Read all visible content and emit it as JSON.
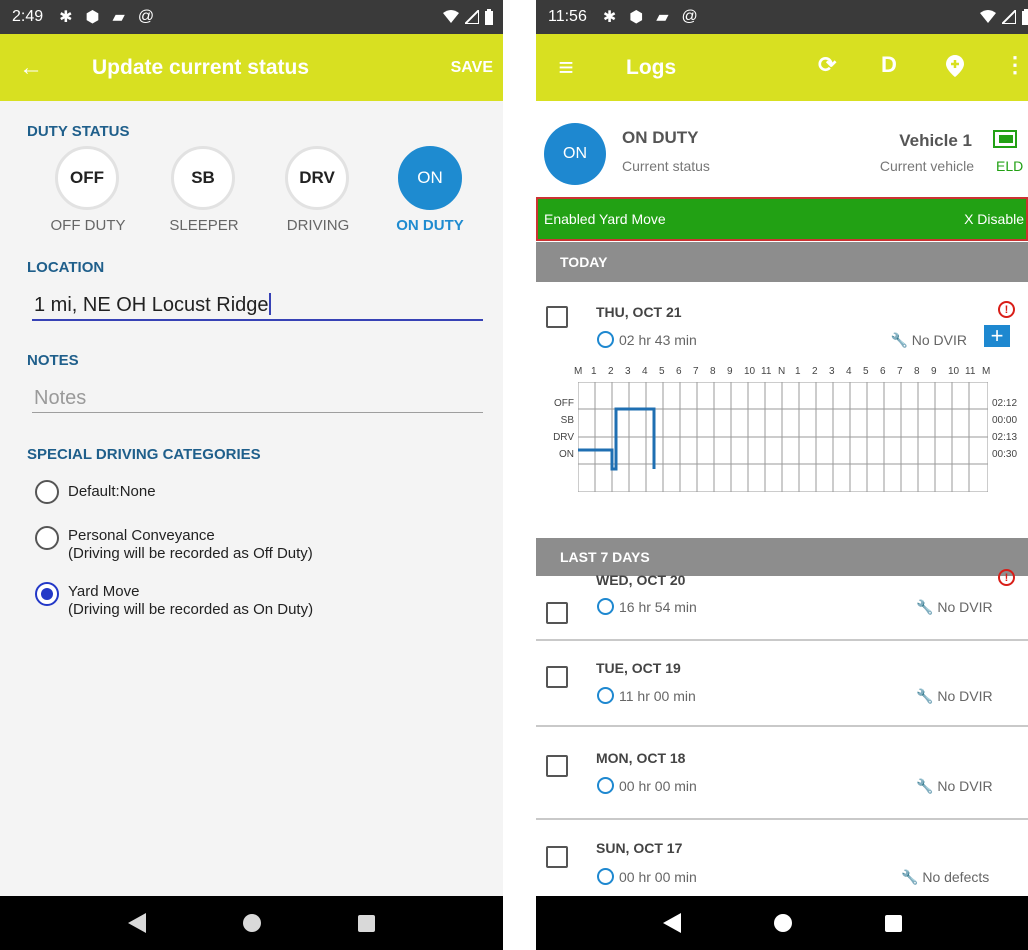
{
  "left": {
    "statusbar": {
      "time": "2:49"
    },
    "appbar": {
      "title": "Update current status",
      "save": "SAVE"
    },
    "duty_status": {
      "label": "DUTY STATUS",
      "options": [
        {
          "code": "OFF",
          "label": "OFF DUTY"
        },
        {
          "code": "SB",
          "label": "SLEEPER"
        },
        {
          "code": "DRV",
          "label": "DRIVING"
        },
        {
          "code": "ON",
          "label": "ON DUTY"
        }
      ],
      "selected": "ON"
    },
    "location": {
      "label": "LOCATION",
      "value": "1 mi, NE OH Locust Ridge"
    },
    "notes": {
      "label": "NOTES",
      "placeholder": "Notes"
    },
    "special": {
      "label": "SPECIAL DRIVING CATEGORIES",
      "options": [
        {
          "line1": "Default:None",
          "line2": ""
        },
        {
          "line1": "Personal Conveyance",
          "line2": "(Driving will be recorded as Off Duty)"
        },
        {
          "line1": "Yard Move",
          "line2": "(Driving will be recorded as On Duty)"
        }
      ],
      "selected_index": 2
    }
  },
  "right": {
    "statusbar": {
      "time": "11:56"
    },
    "appbar": {
      "title": "Logs",
      "d_icon": "D"
    },
    "status": {
      "circle": "ON",
      "title": "ON DUTY",
      "subtitle": "Current status"
    },
    "vehicle": {
      "title": "Vehicle 1",
      "subtitle": "Current vehicle",
      "eld": "ELD"
    },
    "yard_bar": {
      "text": "Enabled Yard Move",
      "disable": "X Disable"
    },
    "today_header": "TODAY",
    "today": {
      "date": "THU, OCT 21",
      "hours": "02 hr  43 min",
      "dvir": "No DVIR",
      "warning": true
    },
    "graph": {
      "hour_labels": [
        "M",
        "1",
        "2",
        "3",
        "4",
        "5",
        "6",
        "7",
        "8",
        "9",
        "10",
        "11",
        "N",
        "1",
        "2",
        "3",
        "4",
        "5",
        "6",
        "7",
        "8",
        "9",
        "10",
        "11",
        "M"
      ],
      "rows": [
        "OFF",
        "SB",
        "DRV",
        "ON"
      ],
      "totals": [
        "02:12",
        "00:00",
        "02:13",
        "00:30"
      ]
    },
    "last7_header": "LAST 7 DAYS",
    "logs": [
      {
        "date": "WED, OCT 20",
        "hours": "16 hr  54 min",
        "dvir": "No DVIR",
        "warning": true
      },
      {
        "date": "TUE, OCT 19",
        "hours": "11 hr  00 min",
        "dvir": "No DVIR",
        "warning": false
      },
      {
        "date": "MON, OCT 18",
        "hours": "00 hr  00 min",
        "dvir": "No DVIR",
        "warning": false
      },
      {
        "date": "SUN, OCT 17",
        "hours": "00 hr  00 min",
        "dvir": "No defects",
        "warning": false
      }
    ]
  },
  "colors": {
    "appbar": "#d8e021",
    "accent": "#1e88d0",
    "yard_green": "#22a114",
    "section": "#1f5f8b"
  }
}
